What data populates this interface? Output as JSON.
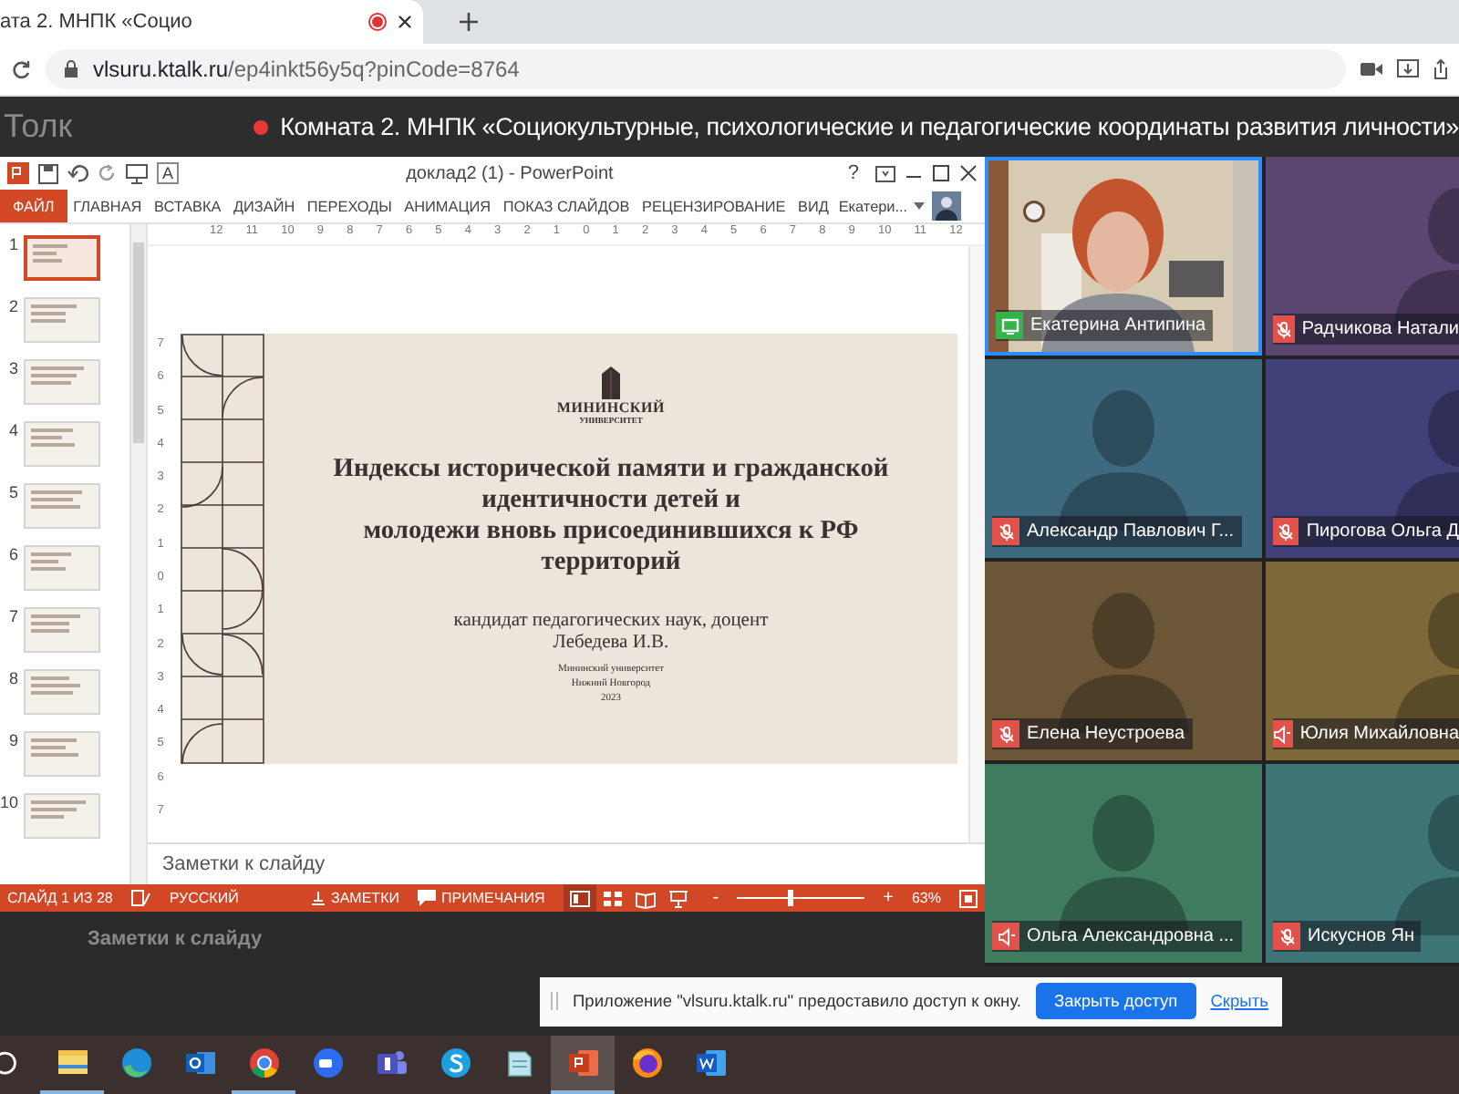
{
  "browser": {
    "tab": {
      "title": "ата 2. МНПК «Социо",
      "recording": true
    },
    "address": {
      "domain": "vlsuru.ktalk.ru",
      "path": "/ep4inkt56y5q?pinCode=8764"
    }
  },
  "app_header": {
    "brand": "Толк",
    "live": true,
    "room_title": "Комната 2. МНПК «Социокультурные, психологические и педагогические координаты развития личности»"
  },
  "powerpoint": {
    "title": "доклад2 (1) - PowerPoint",
    "font_button": "A",
    "help": "?",
    "ribbon_tabs": [
      {
        "label": "ФАЙЛ",
        "kind": "file"
      },
      {
        "label": "ГЛАВНАЯ",
        "kind": "tab"
      },
      {
        "label": "ВСТАВКА",
        "kind": "tab"
      },
      {
        "label": "ДИЗАЙН",
        "kind": "tab"
      },
      {
        "label": "ПЕРЕХОДЫ",
        "kind": "tab"
      },
      {
        "label": "АНИМАЦИЯ",
        "kind": "tab"
      },
      {
        "label": "ПОКАЗ СЛАЙДОВ",
        "kind": "tab"
      },
      {
        "label": "РЕЦЕНЗИРОВАНИЕ",
        "kind": "tab"
      },
      {
        "label": "ВИД",
        "kind": "tab"
      }
    ],
    "account": "Екатери...",
    "ruler_h": [
      "12",
      "11",
      "10",
      "9",
      "8",
      "7",
      "6",
      "5",
      "4",
      "3",
      "2",
      "1",
      "0",
      "1",
      "2",
      "3",
      "4",
      "5",
      "6",
      "7",
      "8",
      "9",
      "10",
      "11",
      "12"
    ],
    "ruler_v": [
      "7",
      "6",
      "5",
      "4",
      "3",
      "2",
      "1",
      "0",
      "1",
      "2",
      "3",
      "4",
      "5",
      "6",
      "7"
    ],
    "thumbnails": [
      {
        "number": "1",
        "selected": true
      },
      {
        "number": "2",
        "selected": false
      },
      {
        "number": "3",
        "selected": false
      },
      {
        "number": "4",
        "selected": false
      },
      {
        "number": "5",
        "selected": false
      },
      {
        "number": "6",
        "selected": false
      },
      {
        "number": "7",
        "selected": false
      },
      {
        "number": "8",
        "selected": false
      },
      {
        "number": "9",
        "selected": false
      },
      {
        "number": "10",
        "selected": false
      }
    ],
    "slide": {
      "logo_name": "МИНИНСКИЙ",
      "logo_sub": "УНИВЕРСИТЕТ",
      "title_lines": [
        "Индексы исторической памяти и гражданской идентичности детей и",
        "молодежи вновь присоединившихся к РФ территорий"
      ],
      "subtitle_lines": [
        "кандидат педагогических наук, доцент",
        "Лебедева И.В."
      ],
      "small_lines": [
        "Мининский университет",
        "Нижний Новгород",
        "2023"
      ]
    },
    "notes": "Заметки к слайду",
    "status": {
      "slide": "СЛАЙД 1 ИЗ 28",
      "language": "РУССКИЙ",
      "notes_button": "ЗАМЕТКИ",
      "comments_button": "ПРИМЕЧАНИЯ",
      "views": [
        {
          "kind": "normal",
          "selected": true
        },
        {
          "kind": "sorter",
          "selected": false
        },
        {
          "kind": "reading",
          "selected": false
        },
        {
          "kind": "show",
          "selected": false
        }
      ],
      "zoom_minus": "-",
      "zoom_plus": "+",
      "level": 0.4,
      "zoom": "63%"
    }
  },
  "shared_window_echo": {
    "notes": "Заметки к слайду"
  },
  "participants": [
    {
      "name": "Екатерина Антипина",
      "kind": "video",
      "status_icon": {
        "kind": "camera"
      },
      "speaking": true,
      "color": "#c9b79c"
    },
    {
      "name": "Радчикова Натали",
      "kind": "avatar",
      "status_icon": {
        "kind": "muted"
      },
      "speaking": false,
      "color": "#5b4672"
    },
    {
      "name": "Александр Павлович Г...",
      "kind": "avatar",
      "status_icon": {
        "kind": "muted"
      },
      "speaking": false,
      "color": "#3e6a80"
    },
    {
      "name": "Пирогова Ольга Д",
      "kind": "avatar",
      "status_icon": {
        "kind": "muted"
      },
      "speaking": false,
      "color": "#41417a"
    },
    {
      "name": "Елена Неустроева",
      "kind": "avatar",
      "status_icon": {
        "kind": "muted"
      },
      "speaking": false,
      "color": "#6b5638"
    },
    {
      "name": "Юлия Михайловна",
      "kind": "avatar",
      "status_icon": {
        "kind": "speaker"
      },
      "speaking": false,
      "color": "#7c6838"
    },
    {
      "name": "Ольга Александровна ...",
      "kind": "avatar",
      "status_icon": {
        "kind": "speaker"
      },
      "speaking": false,
      "color": "#3f7b5e"
    },
    {
      "name": "Искуснов Ян",
      "kind": "avatar",
      "status_icon": {
        "kind": "muted"
      },
      "speaking": false,
      "color": "#3e7677"
    }
  ],
  "notification": {
    "text": "Приложение \"vlsuru.ktalk.ru\" предоставило доступ к окну.",
    "button": "Закрыть доступ",
    "link": "Скрыть"
  },
  "taskbar": [
    {
      "kind": "search",
      "running": false,
      "active": false
    },
    {
      "kind": "folder",
      "running": true,
      "active": false
    },
    {
      "kind": "edge",
      "running": false,
      "active": false
    },
    {
      "kind": "outlook",
      "running": false,
      "active": false
    },
    {
      "kind": "chrome",
      "running": true,
      "active": false
    },
    {
      "kind": "zoom",
      "running": false,
      "active": false
    },
    {
      "kind": "teams",
      "running": false,
      "active": false
    },
    {
      "kind": "skype",
      "running": false,
      "active": false
    },
    {
      "kind": "notepad",
      "running": false,
      "active": false
    },
    {
      "kind": "powerpoint",
      "running": true,
      "active": true
    },
    {
      "kind": "firefox",
      "running": false,
      "active": false
    },
    {
      "kind": "word",
      "running": false,
      "active": false
    }
  ]
}
